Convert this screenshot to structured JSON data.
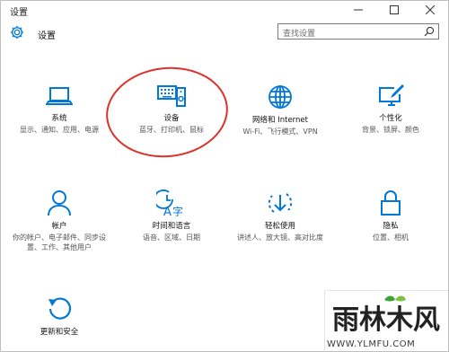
{
  "window": {
    "title": "设置"
  },
  "header": {
    "title": "设置",
    "search_placeholder": "查找设置"
  },
  "tiles": [
    {
      "name": "系统",
      "desc": "显示、通知、应用、电源"
    },
    {
      "name": "设备",
      "desc": "蓝牙、打印机、鼠标"
    },
    {
      "name": "网络和 Internet",
      "desc": "Wi-Fi、飞行模式、VPN"
    },
    {
      "name": "个性化",
      "desc": "背景、锁屏、颜色"
    },
    {
      "name": "帐户",
      "desc": "你的帐户、电子邮件、同步设置、工作、其他用户"
    },
    {
      "name": "时间和语言",
      "desc": "语音、区域、日期"
    },
    {
      "name": "轻松使用",
      "desc": "讲述人、放大镜、高对比度"
    },
    {
      "name": "隐私",
      "desc": "位置、相机"
    },
    {
      "name": "更新和安全",
      "desc": ""
    }
  ],
  "watermark": {
    "brand": "雨林木风",
    "url": "WWW.YLMFU.COM"
  },
  "colors": {
    "accent": "#0078d7",
    "marker": "#e0302b"
  }
}
